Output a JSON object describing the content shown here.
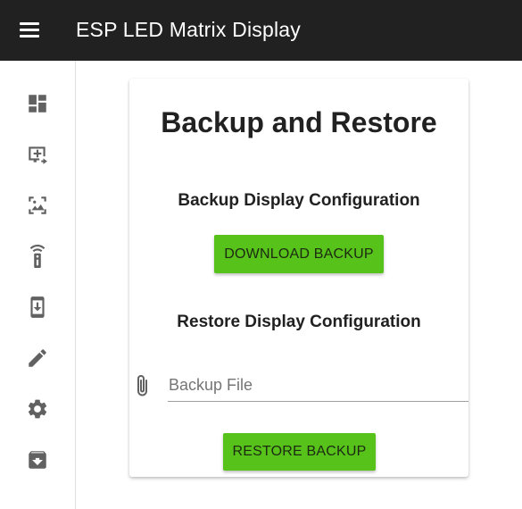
{
  "appbar": {
    "title": "ESP LED Matrix Display",
    "menu_icon": "hamburger-menu-icon"
  },
  "sidebar": {
    "items": [
      {
        "icon": "dashboard-icon"
      },
      {
        "icon": "add-to-screen-icon"
      },
      {
        "icon": "photo-frame-icon"
      },
      {
        "icon": "remote-control-icon"
      },
      {
        "icon": "phone-download-icon"
      },
      {
        "icon": "pencil-icon"
      },
      {
        "icon": "gear-icon"
      },
      {
        "icon": "archive-icon"
      }
    ]
  },
  "card": {
    "title": "Backup and Restore",
    "backup_heading": "Backup Display Configuration",
    "download_button": "DOWNLOAD BACKUP",
    "restore_heading": "Restore Display Configuration",
    "file_placeholder": "Backup File",
    "restore_button": "RESTORE BACKUP"
  },
  "colors": {
    "appbar": "#212121",
    "accent_green": "#56c21a",
    "icon_gray": "#616161"
  }
}
